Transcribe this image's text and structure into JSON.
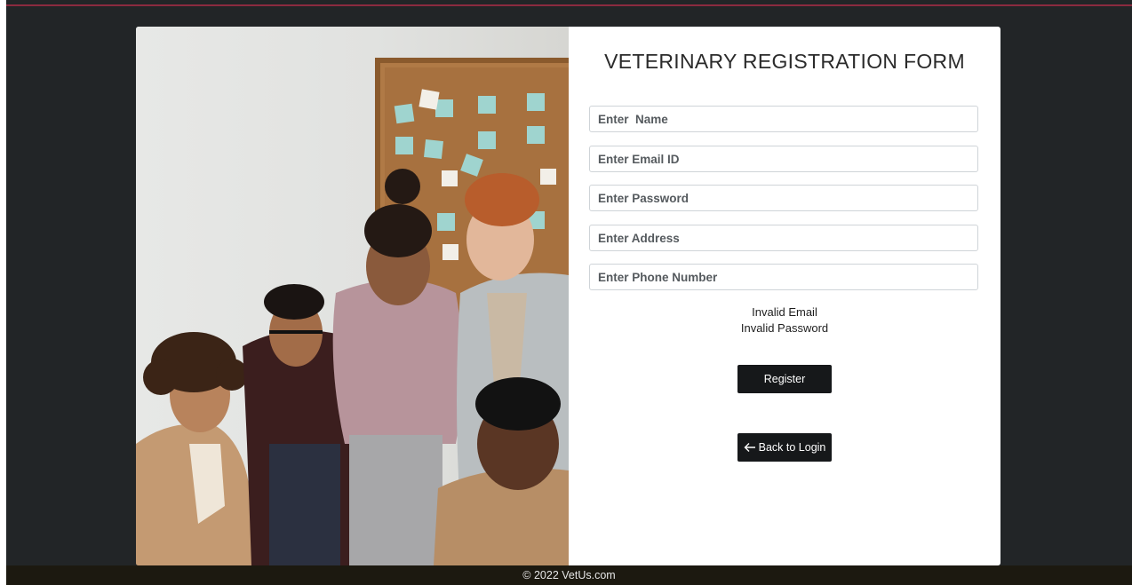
{
  "form": {
    "title": "VETERINARY REGISTRATION FORM",
    "fields": [
      {
        "placeholder": "Enter  Name"
      },
      {
        "placeholder": "Enter Email ID"
      },
      {
        "placeholder": "Enter Password"
      },
      {
        "placeholder": "Enter Address"
      },
      {
        "placeholder": "Enter Phone Number"
      }
    ],
    "errors": [
      "Invalid Email",
      "Invalid Password"
    ],
    "register_label": "Register",
    "back_icon": "left-arrow-icon",
    "back_label": "Back to Login"
  },
  "footer": {
    "text": "© 2022 VetUs.com"
  },
  "colors": {
    "background": "#222527",
    "accent_line": "#8b2a3f",
    "button": "#16181a",
    "footer": "#1c1910"
  }
}
